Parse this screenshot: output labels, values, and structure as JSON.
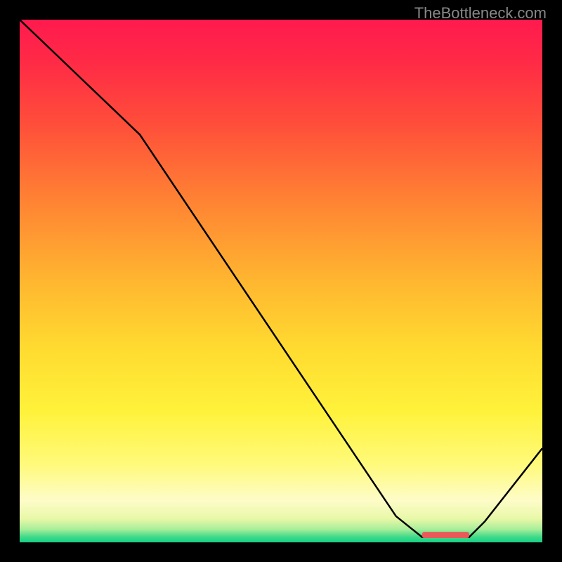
{
  "watermark": "TheBottleneck.com",
  "chart_data": {
    "type": "line",
    "title": "",
    "xlabel": "",
    "ylabel": "",
    "xlim": [
      0,
      100
    ],
    "ylim": [
      0,
      100
    ],
    "grid": false,
    "legend": false,
    "background_gradient": {
      "stops": [
        {
          "offset": 0.0,
          "color": "#FF1A4E"
        },
        {
          "offset": 0.08,
          "color": "#FF2A46"
        },
        {
          "offset": 0.2,
          "color": "#FF4E3A"
        },
        {
          "offset": 0.35,
          "color": "#FF8433"
        },
        {
          "offset": 0.5,
          "color": "#FFB630"
        },
        {
          "offset": 0.63,
          "color": "#FFDB30"
        },
        {
          "offset": 0.75,
          "color": "#FFF23B"
        },
        {
          "offset": 0.85,
          "color": "#FFFA7A"
        },
        {
          "offset": 0.92,
          "color": "#FEFCC8"
        },
        {
          "offset": 0.955,
          "color": "#E8F8A8"
        },
        {
          "offset": 0.975,
          "color": "#A8EE9A"
        },
        {
          "offset": 0.99,
          "color": "#3ED989"
        },
        {
          "offset": 1.0,
          "color": "#14D184"
        }
      ]
    },
    "series": [
      {
        "name": "bottleneck-curve",
        "color": "#000000",
        "x": [
          0,
          23,
          72,
          77,
          86,
          89,
          100
        ],
        "y": [
          100,
          78,
          5,
          1,
          1,
          4,
          18
        ]
      }
    ],
    "marker": {
      "name": "optimal-range-marker",
      "color": "#E85A5A",
      "x_start": 77,
      "x_end": 86,
      "y": 0.8,
      "height": 1.2
    }
  }
}
